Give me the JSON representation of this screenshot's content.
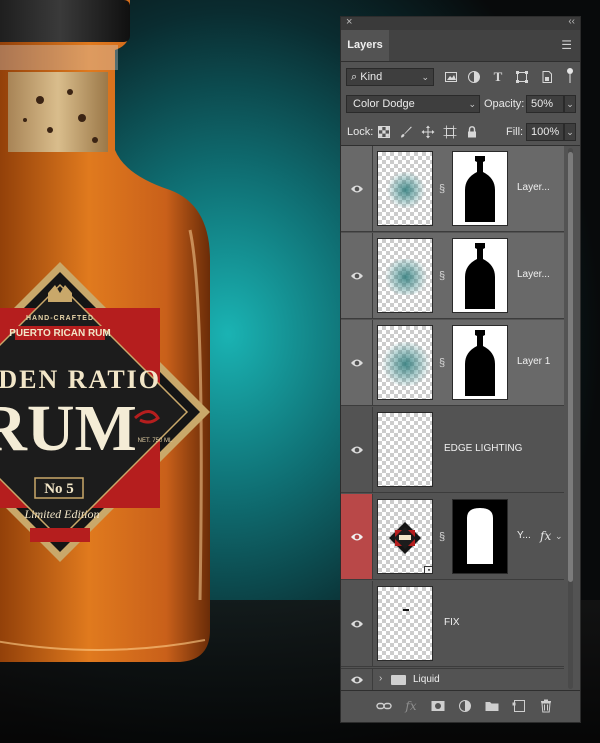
{
  "panel": {
    "close_glyph": "×",
    "collapse_glyph": "‹‹",
    "tab_label": "Layers",
    "menu_glyph": "☰",
    "filter_kind": "Kind",
    "blend_mode": "Color Dodge",
    "opacity_label": "Opacity:",
    "opacity_value": "50%",
    "lock_label": "Lock:",
    "fill_label": "Fill:",
    "fill_value": "100%"
  },
  "artwork": {
    "label_tagline": "HAND-CRAFTED",
    "label_subtitle": "PUERTO RICAN RUM",
    "label_brand": "LDEN RATIO",
    "label_word": "RUM",
    "label_volume": "NET. 750 ML",
    "label_number": "No 5",
    "label_edition": "Limited Edition"
  },
  "layers": [
    {
      "name": "Layer...",
      "visible": true,
      "selected": true,
      "type": "glow-masked"
    },
    {
      "name": "Layer...",
      "visible": true,
      "selected": true,
      "type": "glow-masked"
    },
    {
      "name": "Layer 1",
      "visible": true,
      "selected": true,
      "type": "glow-masked"
    },
    {
      "name": "EDGE LIGHTING",
      "visible": true,
      "selected": false,
      "type": "plain"
    },
    {
      "name": "Y...",
      "visible": true,
      "selected": false,
      "type": "smart-masked-fx",
      "eye_color": "#b94848"
    },
    {
      "name": "FIX",
      "visible": true,
      "selected": false,
      "type": "plain"
    }
  ],
  "group": {
    "name": "Liquid"
  },
  "colors": {
    "panel_bg": "#535353",
    "selected_row": "#696969",
    "eye_highlight": "#b94848",
    "glow": "#2b8a8a"
  },
  "icons": {
    "filter": [
      "image-filter-icon",
      "adjustment-filter-icon",
      "type-filter-icon",
      "shape-filter-icon",
      "smart-object-filter-icon"
    ],
    "lock": [
      "lock-transparent-icon",
      "lock-paint-icon",
      "lock-position-icon",
      "lock-artboard-icon",
      "lock-all-icon"
    ],
    "bottom": [
      "link-layers-icon",
      "fx-icon",
      "add-mask-icon",
      "adjustment-layer-icon",
      "new-group-icon",
      "new-layer-icon",
      "delete-icon"
    ]
  }
}
